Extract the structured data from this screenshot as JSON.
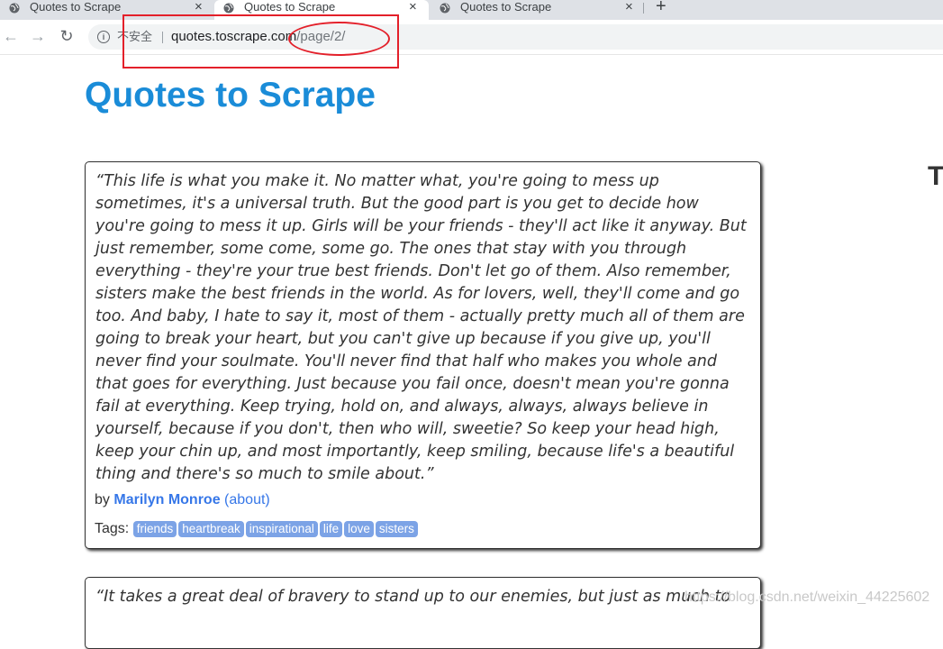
{
  "browser": {
    "tabs": [
      {
        "title": "Quotes to Scrape",
        "active": false
      },
      {
        "title": "Quotes to Scrape",
        "active": true
      },
      {
        "title": "Quotes to Scrape",
        "active": false
      }
    ],
    "new_tab_label": "+",
    "close_label": "×",
    "security_label": "不安全",
    "url_host": "quotes.toscrape.com",
    "url_path": "/page/2/",
    "nav": {
      "back": "←",
      "forward": "→",
      "reload": "↻"
    }
  },
  "page": {
    "title": "Quotes to Scrape",
    "right_heading": "T",
    "quotes": [
      {
        "text": "“This life is what you make it. No matter what, you're going to mess up sometimes, it's a universal truth. But the good part is you get to decide how you're going to mess it up. Girls will be your friends - they'll act like it anyway. But just remember, some come, some go. The ones that stay with you through everything - they're your true best friends. Don't let go of them. Also remember, sisters make the best friends in the world. As for lovers, well, they'll come and go too. And baby, I hate to say it, most of them - actually pretty much all of them are going to break your heart, but you can't give up because if you give up, you'll never find your soulmate. You'll never find that half who makes you whole and that goes for everything. Just because you fail once, doesn't mean you're gonna fail at everything. Keep trying, hold on, and always, always, always believe in yourself, because if you don't, then who will, sweetie? So keep your head high, keep your chin up, and most importantly, keep smiling, because life's a beautiful thing and there's so much to smile about.”",
        "by_label": "by",
        "author": "Marilyn Monroe",
        "about_label": "(about)",
        "tags_label": "Tags:",
        "tags": [
          "friends",
          "heartbreak",
          "inspirational",
          "life",
          "love",
          "sisters"
        ]
      },
      {
        "text": "“It takes a great deal of bravery to stand up to our enemies, but just as much to"
      }
    ]
  },
  "watermark": "https://blog.csdn.net/weixin_44225602",
  "colors": {
    "title": "#1a8cd8",
    "link": "#3677e8",
    "tag_bg": "#7ca3e6",
    "annotation": "#e3202a"
  }
}
